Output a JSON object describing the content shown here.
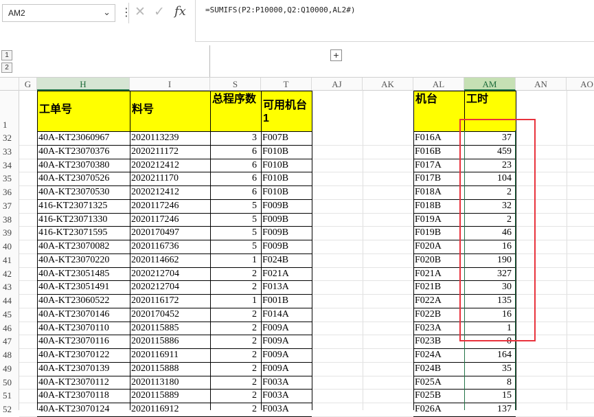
{
  "name_box": {
    "value": "AM2"
  },
  "formula_bar": {
    "formula": "=SUMIFS(P2:P10000,Q2:Q10000,AL2#)"
  },
  "outline": {
    "level1": "1",
    "level2": "2",
    "expand": "+"
  },
  "columns": [
    "G",
    "H",
    "I",
    "S",
    "T",
    "AJ",
    "AK",
    "AL",
    "AM",
    "AN",
    "AO"
  ],
  "headers": {
    "H": "工单号",
    "I": "料号",
    "S": "总程序数",
    "T": "可用机台1",
    "AL": "机台",
    "AM": "工时"
  },
  "header_row_number": "1",
  "rows": [
    {
      "r": "32",
      "h": "40A-KT23060967",
      "i": "2020113239",
      "s": "3",
      "t": "F007B",
      "al": "F016A",
      "am": "37"
    },
    {
      "r": "33",
      "h": "40A-KT23070376",
      "i": "2020211172",
      "s": "6",
      "t": "F010B",
      "al": "F016B",
      "am": "459"
    },
    {
      "r": "34",
      "h": "40A-KT23070380",
      "i": "2020212412",
      "s": "6",
      "t": "F010B",
      "al": "F017A",
      "am": "23"
    },
    {
      "r": "35",
      "h": "40A-KT23070526",
      "i": "2020211170",
      "s": "6",
      "t": "F010B",
      "al": "F017B",
      "am": "104"
    },
    {
      "r": "36",
      "h": "40A-KT23070530",
      "i": "2020212412",
      "s": "6",
      "t": "F010B",
      "al": "F018A",
      "am": "2"
    },
    {
      "r": "37",
      "h": "416-KT23071325",
      "i": "2020117246",
      "s": "5",
      "t": "F009B",
      "al": "F018B",
      "am": "32"
    },
    {
      "r": "38",
      "h": "416-KT23071330",
      "i": "2020117246",
      "s": "5",
      "t": "F009B",
      "al": "F019A",
      "am": "2"
    },
    {
      "r": "39",
      "h": "416-KT23071595",
      "i": "2020170497",
      "s": "5",
      "t": "F009B",
      "al": "F019B",
      "am": "46"
    },
    {
      "r": "40",
      "h": "40A-KT23070082",
      "i": "2020116736",
      "s": "5",
      "t": "F009B",
      "al": "F020A",
      "am": "16"
    },
    {
      "r": "41",
      "h": "40A-KT23070220",
      "i": "2020114662",
      "s": "1",
      "t": "F024B",
      "al": "F020B",
      "am": "190"
    },
    {
      "r": "42",
      "h": "40A-KT23051485",
      "i": "2020212704",
      "s": "2",
      "t": "F021A",
      "al": "F021A",
      "am": "327"
    },
    {
      "r": "43",
      "h": "40A-KT23051491",
      "i": "2020212704",
      "s": "2",
      "t": "F013A",
      "al": "F021B",
      "am": "30"
    },
    {
      "r": "44",
      "h": "40A-KT23060522",
      "i": "2020116172",
      "s": "1",
      "t": "F001B",
      "al": "F022A",
      "am": "135"
    },
    {
      "r": "45",
      "h": "40A-KT23070146",
      "i": "2020170452",
      "s": "2",
      "t": "F014A",
      "al": "F022B",
      "am": "16"
    },
    {
      "r": "46",
      "h": "40A-KT23070110",
      "i": "2020115885",
      "s": "2",
      "t": "F009A",
      "al": "F023A",
      "am": "1"
    },
    {
      "r": "47",
      "h": "40A-KT23070116",
      "i": "2020115886",
      "s": "2",
      "t": "F009A",
      "al": "F023B",
      "am": "0"
    },
    {
      "r": "48",
      "h": "40A-KT23070122",
      "i": "2020116911",
      "s": "2",
      "t": "F009A",
      "al": "F024A",
      "am": "164"
    },
    {
      "r": "49",
      "h": "40A-KT23070139",
      "i": "2020115888",
      "s": "2",
      "t": "F009A",
      "al": "F024B",
      "am": "35"
    },
    {
      "r": "50",
      "h": "40A-KT23070112",
      "i": "2020113180",
      "s": "2",
      "t": "F003A",
      "al": "F025A",
      "am": "8"
    },
    {
      "r": "51",
      "h": "40A-KT23070118",
      "i": "2020115889",
      "s": "2",
      "t": "F003A",
      "al": "F025B",
      "am": "15"
    },
    {
      "r": "52",
      "h": "40A-KT23070124",
      "i": "2020116912",
      "s": "2",
      "t": "F003A",
      "al": "F026A",
      "am": "137"
    }
  ],
  "icons": {
    "cancel": "close-icon",
    "confirm": "check-icon",
    "function": "fx-icon",
    "dropdown": "chevron-down-icon",
    "menu": "vertical-dots-icon"
  },
  "colors": {
    "header_fill": "#ffff00",
    "annotation_box": "#e8323c",
    "selection": "#217346"
  }
}
